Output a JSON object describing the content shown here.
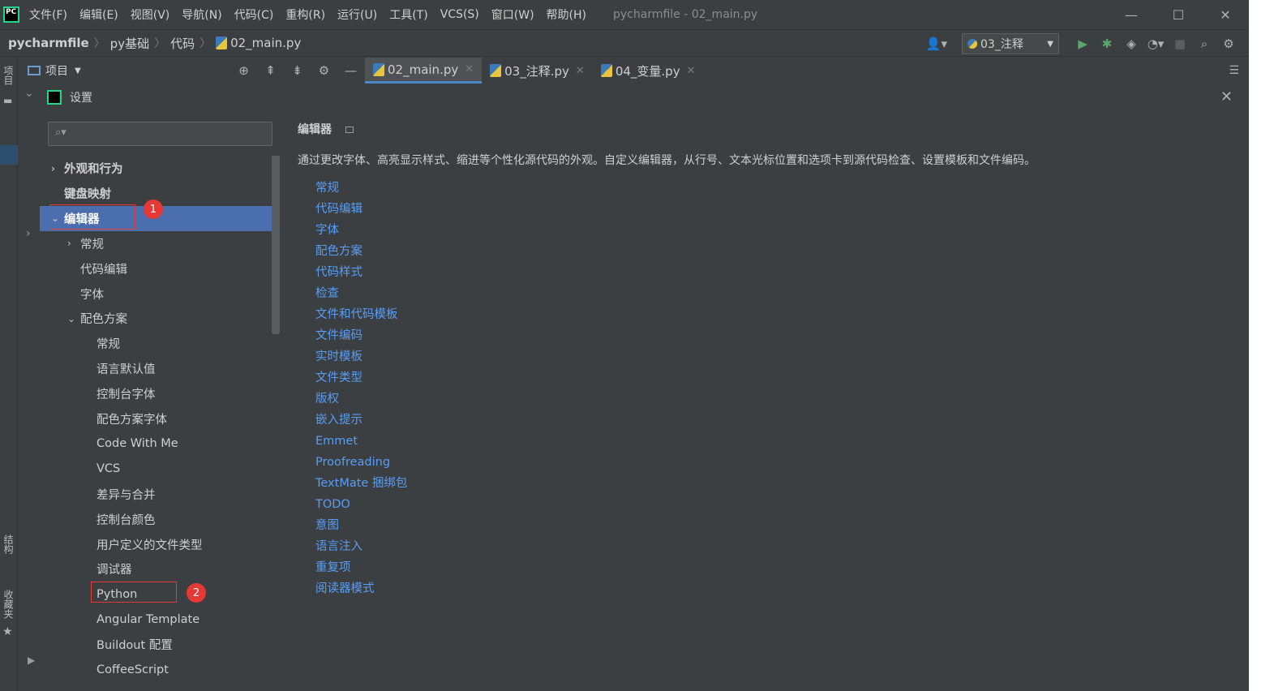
{
  "titlebar": {
    "menu": [
      "文件(F)",
      "编辑(E)",
      "视图(V)",
      "导航(N)",
      "代码(C)",
      "重构(R)",
      "运行(U)",
      "工具(T)",
      "VCS(S)",
      "窗口(W)",
      "帮助(H)"
    ],
    "window_title": "pycharmfile - 02_main.py",
    "controls": [
      "—",
      "☐",
      "✕"
    ]
  },
  "navbar": {
    "breadcrumbs": [
      "pycharmfile",
      "py基础",
      "代码",
      "02_main.py"
    ],
    "run_config": "03_注释"
  },
  "toolwindow": {
    "project_label": "项目",
    "tabs": [
      {
        "label": "02_main.py",
        "active": true
      },
      {
        "label": "03_注释.py",
        "active": false
      },
      {
        "label": "04_变量.py",
        "active": false
      }
    ]
  },
  "left_stripe": {
    "project": "项目",
    "structure": "结构",
    "favorites": "收藏夹"
  },
  "dialog": {
    "title": "设置",
    "search_placeholder": "",
    "tree": [
      {
        "label": "外观和行为",
        "level": 0,
        "arrow": "›",
        "bold": true
      },
      {
        "label": "键盘映射",
        "level": 0,
        "arrow": "",
        "bold": true
      },
      {
        "label": "编辑器",
        "level": 0,
        "arrow": "⌄",
        "bold": true,
        "selected": true
      },
      {
        "label": "常规",
        "level": 1,
        "arrow": "›"
      },
      {
        "label": "代码编辑",
        "level": 1,
        "arrow": ""
      },
      {
        "label": "字体",
        "level": 1,
        "arrow": ""
      },
      {
        "label": "配色方案",
        "level": 1,
        "arrow": "⌄"
      },
      {
        "label": "常规",
        "level": 2,
        "arrow": ""
      },
      {
        "label": "语言默认值",
        "level": 2,
        "arrow": ""
      },
      {
        "label": "控制台字体",
        "level": 2,
        "arrow": ""
      },
      {
        "label": "配色方案字体",
        "level": 2,
        "arrow": ""
      },
      {
        "label": "Code With Me",
        "level": 2,
        "arrow": ""
      },
      {
        "label": "VCS",
        "level": 2,
        "arrow": ""
      },
      {
        "label": "差异与合并",
        "level": 2,
        "arrow": ""
      },
      {
        "label": "控制台颜色",
        "level": 2,
        "arrow": ""
      },
      {
        "label": "用户定义的文件类型",
        "level": 2,
        "arrow": ""
      },
      {
        "label": "调试器",
        "level": 2,
        "arrow": ""
      },
      {
        "label": "Python",
        "level": 2,
        "arrow": ""
      },
      {
        "label": "Angular Template",
        "level": 2,
        "arrow": ""
      },
      {
        "label": "Buildout 配置",
        "level": 2,
        "arrow": ""
      },
      {
        "label": "CoffeeScript",
        "level": 2,
        "arrow": ""
      }
    ],
    "annotations": [
      "1",
      "2"
    ],
    "content": {
      "title": "编辑器",
      "description": "通过更改字体、高亮显示样式、缩进等个性化源代码的外观。自定义编辑器，从行号、文本光标位置和选项卡到源代码检查、设置模板和文件编码。",
      "links": [
        "常规",
        "代码编辑",
        "字体",
        "配色方案",
        "代码样式",
        "检查",
        "文件和代码模板",
        "文件编码",
        "实时模板",
        "文件类型",
        "版权",
        "嵌入提示",
        "Emmet",
        "Proofreading",
        "TextMate 捆绑包",
        "TODO",
        "意图",
        "语言注入",
        "重复项",
        "阅读器模式"
      ]
    }
  },
  "colors": {
    "background": "#3c3f41",
    "selection": "#4b6eaf",
    "link": "#589df6",
    "annotation": "#e53935"
  }
}
